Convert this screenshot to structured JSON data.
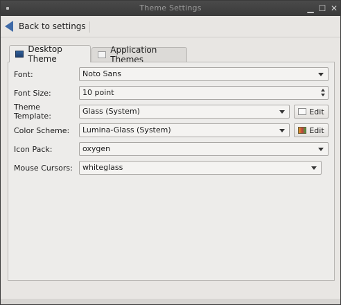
{
  "window": {
    "title": "Theme Settings"
  },
  "toolbar": {
    "back_label": "Back to settings"
  },
  "tabs": [
    {
      "label": "Desktop Theme"
    },
    {
      "label": "Application Themes"
    }
  ],
  "form": {
    "font": {
      "label": "Font:",
      "value": "Noto Sans"
    },
    "font_size": {
      "label": "Font Size:",
      "value": "10 point"
    },
    "theme_template": {
      "label": "Theme Template:",
      "value": "Glass (System)",
      "edit_label": "Edit"
    },
    "color_scheme": {
      "label": "Color Scheme:",
      "value": "Lumina-Glass (System)",
      "edit_label": "Edit"
    },
    "icon_pack": {
      "label": "Icon Pack:",
      "value": "oxygen"
    },
    "mouse_cursors": {
      "label": "Mouse Cursors:",
      "value": "whiteglass"
    }
  },
  "colors": {
    "accent": "#3f6aa7",
    "titlebar": "#3a3a3a",
    "panel": "#edecea"
  }
}
